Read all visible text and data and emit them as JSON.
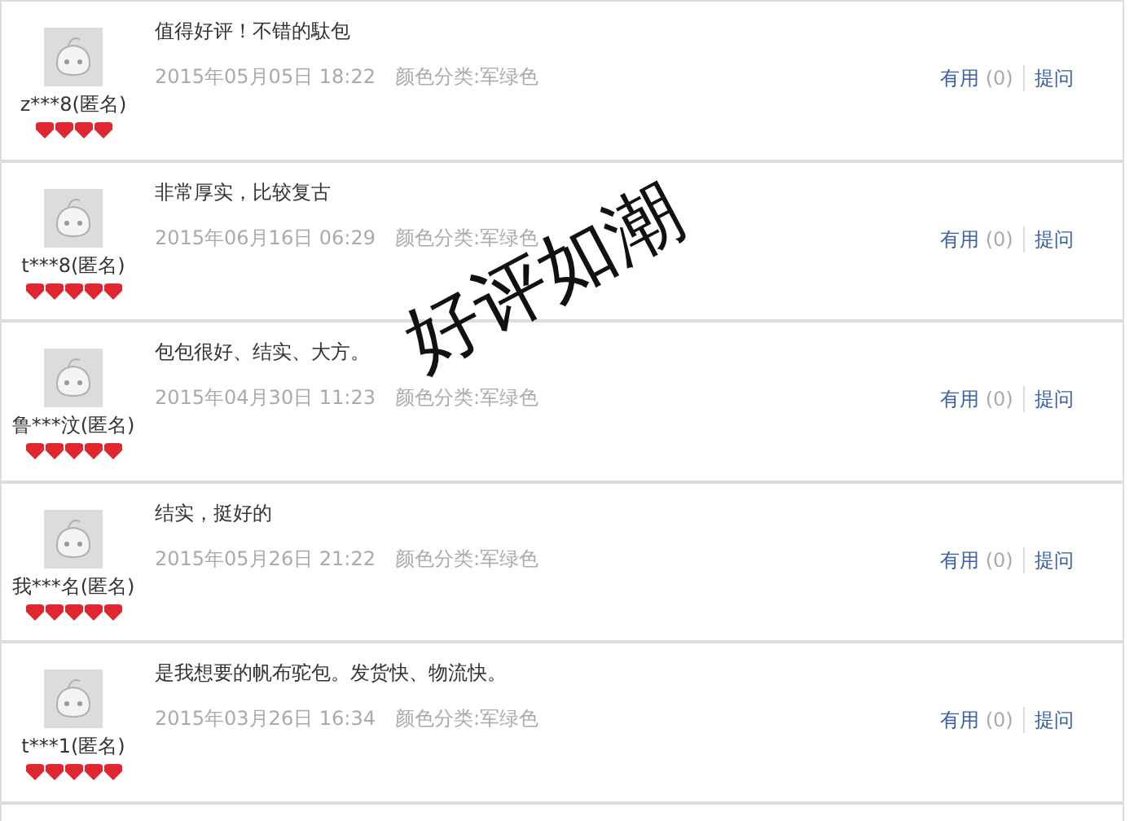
{
  "reviews": [
    {
      "user": "z***8(匿名)",
      "stars": 4,
      "comment": "值得好评！不错的駄包",
      "date": "2015年05月05日 18:22",
      "variant": "颜色分类:军绿色",
      "useful_label": "有用",
      "useful_count": "(0)",
      "ask": "提问"
    },
    {
      "user": "t***8(匿名)",
      "stars": 5,
      "comment": "非常厚实，比较复古",
      "date": "2015年06月16日 06:29",
      "variant": "颜色分类:军绿色",
      "useful_label": "有用",
      "useful_count": "(0)",
      "ask": "提问"
    },
    {
      "user": "鲁***汶(匿名)",
      "stars": 5,
      "comment": "包包很好、结实、大方。",
      "date": "2015年04月30日 11:23",
      "variant": "颜色分类:军绿色",
      "useful_label": "有用",
      "useful_count": "(0)",
      "ask": "提问"
    },
    {
      "user": "我***名(匿名)",
      "stars": 5,
      "comment": "结实，挺好的",
      "date": "2015年05月26日 21:22",
      "variant": "颜色分类:军绿色",
      "useful_label": "有用",
      "useful_count": "(0)",
      "ask": "提问"
    },
    {
      "user": "t***1(匿名)",
      "stars": 5,
      "comment": "是我想要的帆布驼包。发货快、物流快。",
      "date": "2015年03月26日 16:34",
      "variant": "颜色分类:军绿色",
      "useful_label": "有用",
      "useful_count": "(0)",
      "ask": "提问"
    }
  ],
  "stamp": "好评如潮"
}
